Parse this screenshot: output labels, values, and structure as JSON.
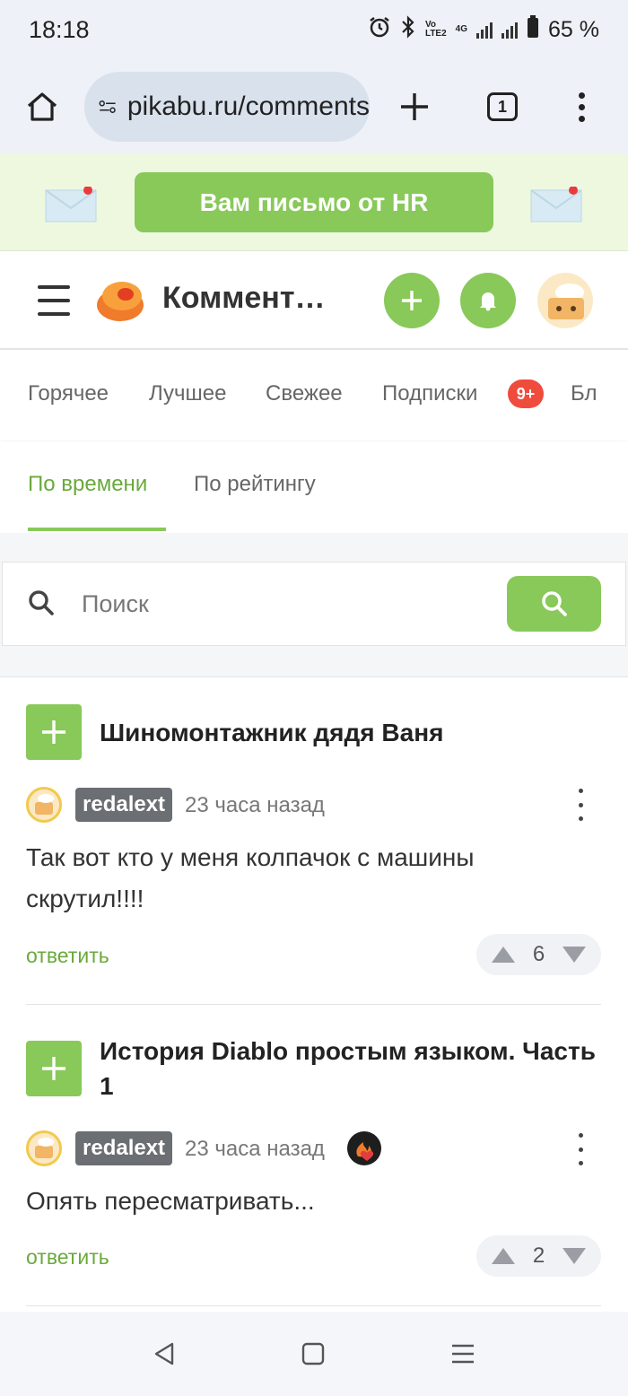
{
  "status_bar": {
    "time": "18:18",
    "battery": "65 %",
    "net_top": "Vo",
    "net_mid": "LTE2",
    "net_gen": "4G"
  },
  "browser": {
    "url": "pikabu.ru/comments",
    "tab_count": "1"
  },
  "banner": {
    "hr_label": "Вам письмо от HR"
  },
  "header": {
    "title": "Комментарии"
  },
  "categories": {
    "hot": "Горячее",
    "best": "Лучшее",
    "fresh": "Свежее",
    "subs": "Подписки",
    "subs_badge": "9+",
    "more": "Бл"
  },
  "sort": {
    "by_time": "По времени",
    "by_rating": "По рейтингу"
  },
  "search": {
    "placeholder": "Поиск",
    "value": ""
  },
  "comments": [
    {
      "post_title": "Шиномонтажник дядя Ваня",
      "user": "redalext",
      "time": "23 часа назад",
      "text": "Так вот кто у меня колпачок с машины скрутил!!!!",
      "reply": "ответить",
      "rating": "6"
    },
    {
      "post_title": "История Diablo простым языком. Часть 1",
      "user": "redalext",
      "time": "23 часа назад",
      "text": "Опять пересматривать...",
      "reply": "ответить",
      "rating": "2"
    }
  ],
  "colors": {
    "accent": "#88c95a",
    "link": "#6aa93c",
    "badge": "#ef4c3d"
  }
}
